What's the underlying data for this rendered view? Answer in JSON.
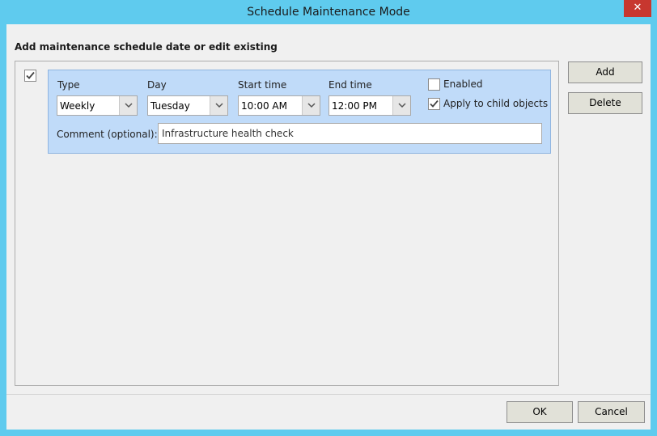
{
  "window": {
    "title": "Schedule Maintenance Mode"
  },
  "heading": "Add maintenance schedule date or edit existing",
  "schedule": {
    "row_selected": true,
    "type_label": "Type",
    "type_value": "Weekly",
    "day_label": "Day",
    "day_value": "Tuesday",
    "start_label": "Start time",
    "start_value": "10:00 AM",
    "end_label": "End time",
    "end_value": "12:00 PM",
    "enabled_label": "Enabled",
    "enabled_checked": false,
    "child_label": "Apply to child objects",
    "child_checked": true,
    "comment_label": "Comment (optional):",
    "comment_value": "Infrastructure health check"
  },
  "side_buttons": {
    "add": "Add",
    "delete": "Delete"
  },
  "footer_buttons": {
    "ok": "OK",
    "cancel": "Cancel"
  },
  "colors": {
    "titlebar": "#5fcbee",
    "card": "#c0dbf9",
    "close": "#c7372f"
  },
  "icons": {
    "close": "close-icon",
    "check": "checkmark-icon",
    "dropdown": "chevron-down-icon"
  }
}
